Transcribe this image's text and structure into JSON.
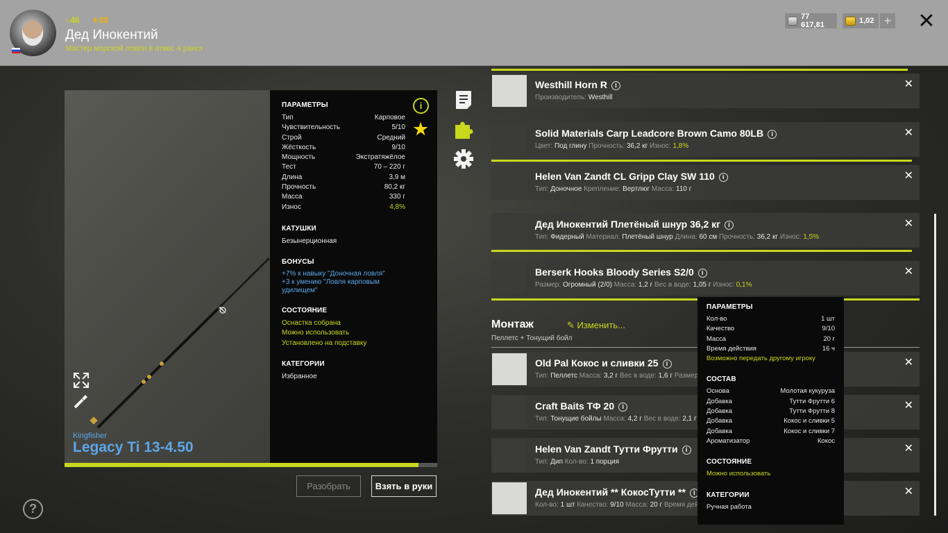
{
  "header": {
    "level": "46",
    "stars": "88",
    "player_name": "Дед Инокентий",
    "rank": "Мастер морской ловли в отвес 4 ранга",
    "silver": "77 617,81",
    "gold": "1,02",
    "plus": "+",
    "close": "✕"
  },
  "rod": {
    "brand": "Kingfisher",
    "model": "Legacy Ti 13-4.50",
    "progress_fraction": 0.95
  },
  "params": {
    "title": "ПАРАМЕТРЫ",
    "rows": [
      {
        "k": "Тип",
        "v": "Карповое"
      },
      {
        "k": "Чувствительность",
        "v": "5/10"
      },
      {
        "k": "Строй",
        "v": "Средний"
      },
      {
        "k": "Жёсткость",
        "v": "9/10"
      },
      {
        "k": "Мощность",
        "v": "Экстратяжёлое"
      },
      {
        "k": "Тест",
        "v": "70 – 220 г"
      },
      {
        "k": "Длина",
        "v": "3,9 м"
      },
      {
        "k": "Прочность",
        "v": "80,2 кг"
      },
      {
        "k": "Масса",
        "v": "330 г"
      },
      {
        "k": "Износ",
        "v": "4,8%"
      }
    ],
    "reels_title": "КАТУШКИ",
    "reels_value": "Безынерционная",
    "bonuses_title": "БОНУСЫ",
    "bonus_1": "+7% к навыку \"Доночная ловля\"",
    "bonus_2": "+3 к умению \"Ловля карповым удилищем\"",
    "state_title": "СОСТОЯНИЕ",
    "state_1": "Оснастка собрана",
    "state_2": "Можно использовать",
    "state_3": "Установлено на подставку",
    "cat_title": "КАТЕГОРИИ",
    "cat_value": "Избранное"
  },
  "buttons": {
    "disassemble": "Разобрать",
    "take": "Взять в руки"
  },
  "tackle": [
    {
      "title": "Westhill Horn R",
      "meta": [
        [
          "Производитель: ",
          "Westhill",
          ""
        ]
      ]
    },
    {
      "title": "Solid Materials Carp Leadcore Brown Camo 80LB",
      "meta": [
        [
          "Цвет: ",
          "Под глину",
          ""
        ],
        [
          " Прочность: ",
          "36,2 кг",
          ""
        ],
        [
          " Износ: ",
          "1,8%",
          "g"
        ]
      ]
    },
    {
      "title": "Helen Van Zandt CL Gripp Clay SW 110",
      "meta": [
        [
          "Тип: ",
          "Доночное",
          ""
        ],
        [
          " Крепление: ",
          "Вертлюг",
          ""
        ],
        [
          " Масса: ",
          "110 г",
          ""
        ]
      ]
    },
    {
      "title": "Дед Инокентий Плетёный шнур 36,2 кг",
      "meta": [
        [
          "Тип: ",
          "Фидерный",
          ""
        ],
        [
          " Материал: ",
          "Плетёный шнур",
          ""
        ],
        [
          " Длина: ",
          "60 см",
          ""
        ],
        [
          " Прочность: ",
          "36,2 кг",
          ""
        ],
        [
          " Износ: ",
          "1,5%",
          "g"
        ]
      ]
    },
    {
      "title": "Berserk Hooks Bloody Series S2/0",
      "meta": [
        [
          "Размер: ",
          "Огромный (2/0)",
          ""
        ],
        [
          " Масса: ",
          "1,2 г",
          ""
        ],
        [
          " Вес в воде: ",
          "1,05 г",
          ""
        ],
        [
          " Износ: ",
          "0,1%",
          "g"
        ]
      ]
    }
  ],
  "montage": {
    "title": "Монтаж",
    "edit": "Изменить...",
    "subtitle": "Пеллетс + Тонущий бойл"
  },
  "baits": [
    {
      "title": "Old Pal Кокос и сливки 25",
      "meta": [
        [
          "Тип: ",
          "Пеллетс",
          ""
        ],
        [
          " Масса: ",
          "3,2 г",
          ""
        ],
        [
          " Вес в воде: ",
          "1,6 г",
          ""
        ],
        [
          " Размер",
          "",
          ""
        ]
      ]
    },
    {
      "title": "Craft Baits ТФ 20",
      "meta": [
        [
          "Тип: ",
          "Тонущие бойлы",
          ""
        ],
        [
          " Масса: ",
          "4,2 г",
          ""
        ],
        [
          " Вес в воде: ",
          "2,1 г",
          ""
        ]
      ]
    },
    {
      "title": "Helen Van Zandt Тутти Фрутти",
      "meta": [
        [
          "Тип: ",
          "Дип",
          ""
        ],
        [
          " Кол-во: ",
          "1 порция",
          ""
        ]
      ]
    },
    {
      "title": "Дед Инокентий ** КокосТутти **",
      "meta": [
        [
          "Кол-во: ",
          "1 шт",
          ""
        ],
        [
          " Качество: ",
          "9/10",
          ""
        ],
        [
          " Масса: ",
          "20 г",
          ""
        ],
        [
          " Время дей",
          "",
          ""
        ]
      ]
    }
  ],
  "tooltip": {
    "params_title": "ПАРАМЕТРЫ",
    "params": [
      {
        "k": "Кол-во",
        "v": "1 шт"
      },
      {
        "k": "Качество",
        "v": "9/10"
      },
      {
        "k": "Масса",
        "v": "20 г"
      },
      {
        "k": "Время действия",
        "v": "16 ч"
      }
    ],
    "transfer": "Возможно передать другому игроку",
    "comp_title": "СОСТАВ",
    "comp": [
      {
        "k": "Основа",
        "v": "Молотая кукуруза"
      },
      {
        "k": "Добавка",
        "v": "Тутти Фрутти 6"
      },
      {
        "k": "Добавка",
        "v": "Тутти Фрутти 8"
      },
      {
        "k": "Добавка",
        "v": "Кокос и сливки 5"
      },
      {
        "k": "Добавка",
        "v": "Кокос и сливки 7"
      },
      {
        "k": "Ароматизатор",
        "v": "Кокос"
      }
    ],
    "state_title": "СОСТОЯНИЕ",
    "state": "Можно использовать",
    "cat_title": "КАТЕГОРИИ",
    "cat": "Ручная работа"
  },
  "icons": {
    "level": "circle-icon",
    "stars": "star-icon",
    "info": "info-icon",
    "favorite": "star-icon",
    "notes": "document-icon",
    "puzzle": "puzzle-icon",
    "settings": "gear-icon",
    "help": "question-icon",
    "expand": "expand-icon",
    "tool": "wrench-icon"
  },
  "colors": {
    "accent": "#c8d81e",
    "link_blue": "#5ca7e8",
    "star": "#f4d70e"
  }
}
